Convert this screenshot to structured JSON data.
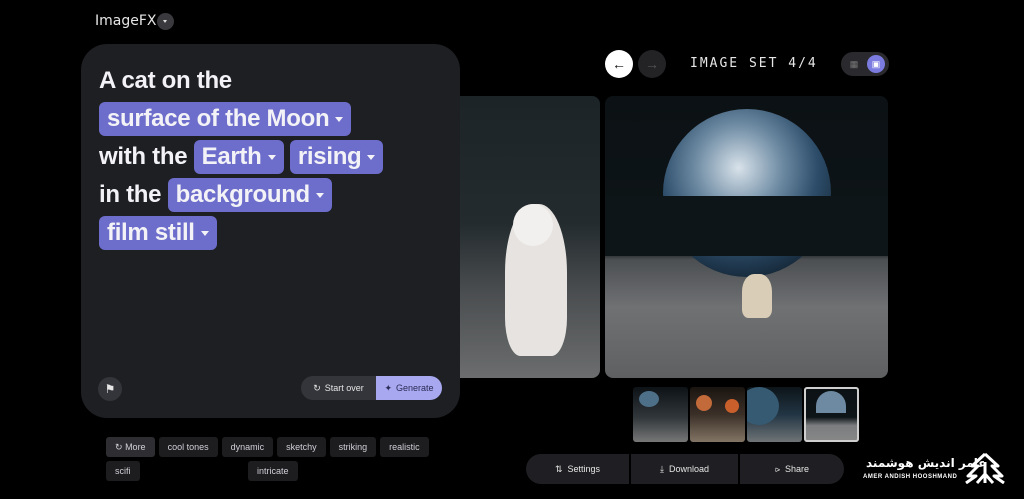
{
  "app": {
    "title": "ImageFX"
  },
  "image_set": {
    "label": "IMAGE SET 4/4"
  },
  "prompt": {
    "segments": [
      {
        "text": "A cat on the",
        "chip": false
      },
      {
        "text": "surface of the Moon",
        "chip": true
      },
      {
        "text": "with the",
        "chip": false
      },
      {
        "text": "Earth",
        "chip": true
      },
      {
        "text": "rising",
        "chip": true
      },
      {
        "text": "in the",
        "chip": false
      },
      {
        "text": "background",
        "chip": true
      },
      {
        "text": "film still",
        "chip": true
      }
    ]
  },
  "buttons": {
    "start_over": "Start over",
    "generate": "Generate",
    "more": "More"
  },
  "suggestions": [
    "cool tones",
    "dynamic",
    "sketchy",
    "striking",
    "realistic",
    "scifi",
    "intricate"
  ],
  "actions": {
    "settings": "Settings",
    "download": "Download",
    "share": "Share"
  },
  "watermark": {
    "persian": "عامر اندیش هوشمند",
    "english": "AMER ANDISH HOOSHMAND"
  },
  "colors": {
    "chip": "#6d6dcb",
    "generate": "#a8a8f0",
    "card": "#1e1f23"
  }
}
